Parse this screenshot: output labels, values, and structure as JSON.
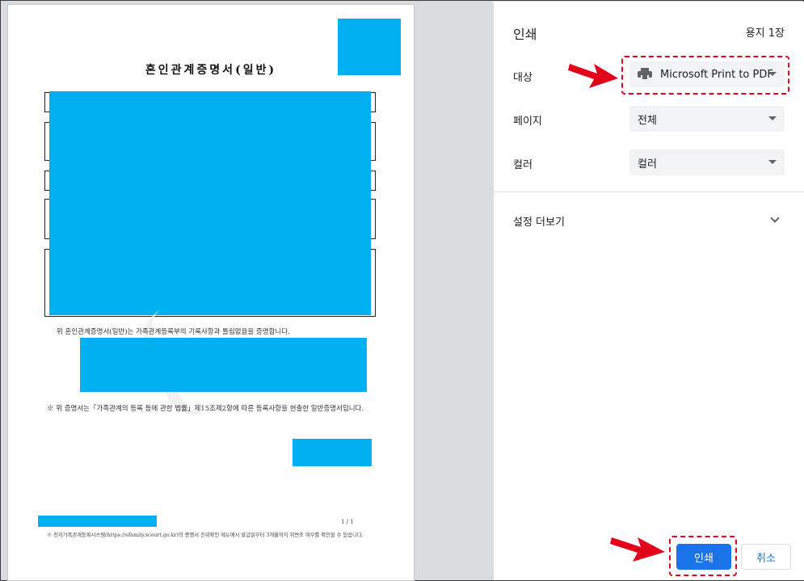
{
  "document": {
    "title": "혼인관계증명서(일반)",
    "statement": "위 혼인관계증명서(일반)는 가족관계등록부의 기록사항과 틀림없음을 증명합니다.",
    "note": "※ 위 증명서는「가족관계의 등록 등에 관한 법률」제15조제2항에 따른 등록사항을 현출한 일반증명서입니다.",
    "page_number": "1 / 1",
    "footer": "※ 전자가족관계등록시스템(https://efamily.scourt.go.kr)의 증명서 진위확인 메뉴에서 발급일부터 3개월까지 위변조 여부를 확인할 수 있습니다."
  },
  "panel": {
    "title": "인쇄",
    "sheets": "용지 1장",
    "destination": {
      "label": "대상",
      "value": "Microsoft Print to PDF",
      "icon": "printer-icon"
    },
    "pages": {
      "label": "페이지",
      "value": "전체"
    },
    "color": {
      "label": "컬러",
      "value": "컬러"
    },
    "more_settings": "설정 더보기",
    "print_button": "인쇄",
    "cancel_button": "취소"
  },
  "colors": {
    "redaction": "#00b0f0",
    "primary": "#1a73e8",
    "annotation": "#e3001b"
  }
}
